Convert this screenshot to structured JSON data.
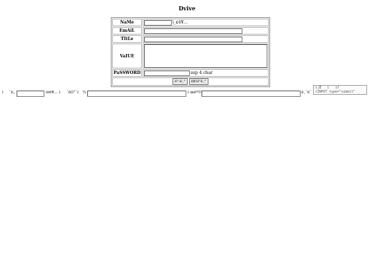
{
  "page": {
    "title": "Dvive"
  },
  "form": {
    "name_label": "NaMe",
    "name_hint": "ì¸¢ë¥…",
    "email_label": "EmAiL",
    "title_label": "TItLe",
    "value_label": "VaIUE",
    "password_label": "PaSSWORD",
    "password_hint": "sup 4 char",
    "submit_button": "ë°›ê¸°",
    "reset_button": "ì§€ìš°ê¸°",
    "fields": {
      "name": "",
      "email": "",
      "title": "",
      "value": "",
      "password": ""
    }
  },
  "search_bar": {
    "label_1": "ì",
    "label_2": "ˆë„",
    "field_1": "",
    "label_3": "ì¤ë¥… ì",
    "label_4": "ˆê(ì°¨)",
    "label_5": "¼",
    "field_2": "",
    "label_6": "ì œëª©",
    "field_3": "",
    "label_7": "ê¸ˆë¨"
  },
  "tooltip": {
    "line1": "ì¡Œ   ì   ìf",
    "line2": "<INPUT type=\"submit\""
  }
}
